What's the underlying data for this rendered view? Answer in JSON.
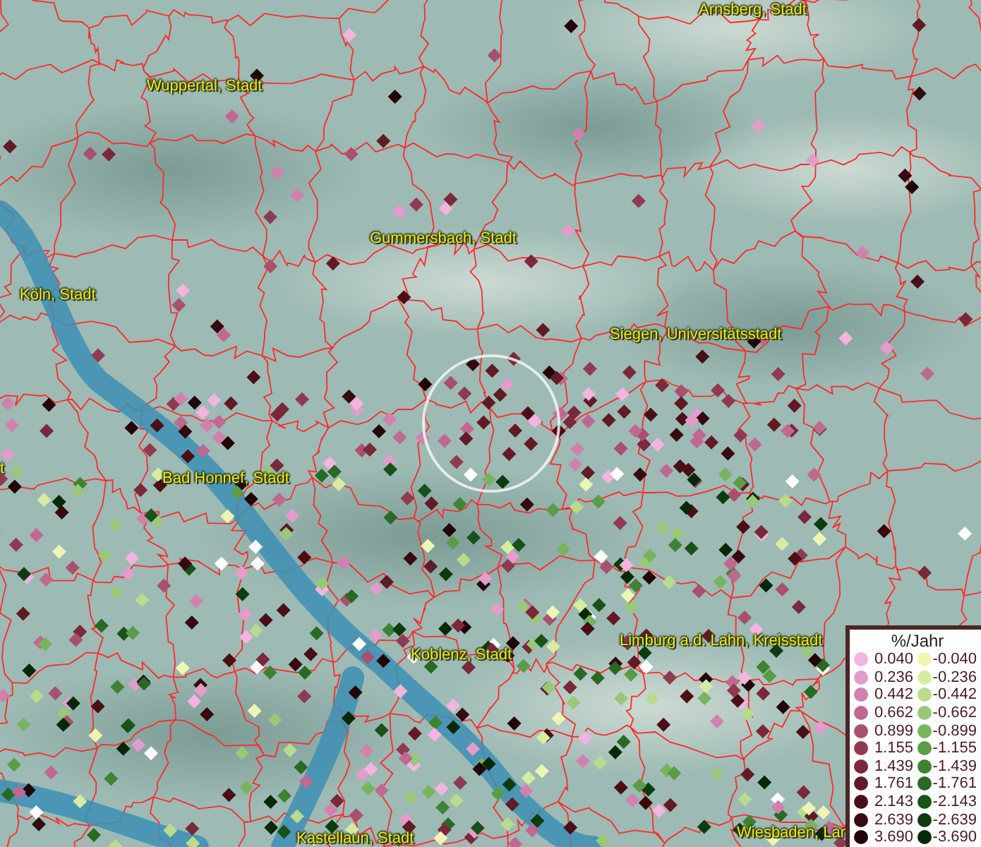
{
  "map": {
    "place_labels": [
      "Arnsberg, Stadt",
      "Wuppertal, Stadt",
      "Gummersbach, Stadt",
      "Köln, Stadt",
      "Siegen, Universitätsstadt",
      "t",
      "Bad Honnef, Stadt",
      "Limburg a.d. Lahn, Kreisstadt",
      "Koblenz, Stadt",
      "Kastellaun, Stadt",
      "Wiesbaden, Lar"
    ]
  },
  "legend": {
    "title": "%/Jahr",
    "rows": [
      {
        "positive": {
          "value": "0.040",
          "color": "#f4b4e0"
        },
        "negative": {
          "value": "-0.040",
          "color": "#eef6b4"
        }
      },
      {
        "positive": {
          "value": "0.236",
          "color": "#e49ccc"
        },
        "negative": {
          "value": "-0.236",
          "color": "#d6eca0"
        }
      },
      {
        "positive": {
          "value": "0.442",
          "color": "#d280ae"
        },
        "negative": {
          "value": "-0.442",
          "color": "#b8dc8c"
        }
      },
      {
        "positive": {
          "value": "0.662",
          "color": "#c06890"
        },
        "negative": {
          "value": "-0.662",
          "color": "#98c878"
        }
      },
      {
        "positive": {
          "value": "0.899",
          "color": "#a8506e"
        },
        "negative": {
          "value": "-0.899",
          "color": "#78b460"
        }
      },
      {
        "positive": {
          "value": "1.155",
          "color": "#903a52"
        },
        "negative": {
          "value": "-1.155",
          "color": "#5a9c48"
        }
      },
      {
        "positive": {
          "value": "1.439",
          "color": "#7a283a"
        },
        "negative": {
          "value": "-1.439",
          "color": "#3e8234"
        }
      },
      {
        "positive": {
          "value": "1.761",
          "color": "#621a24"
        },
        "negative": {
          "value": "-1.761",
          "color": "#286a24"
        }
      },
      {
        "positive": {
          "value": "2.143",
          "color": "#4a0f16"
        },
        "negative": {
          "value": "-2.143",
          "color": "#185218"
        }
      },
      {
        "positive": {
          "value": "2.639",
          "color": "#360a0e"
        },
        "negative": {
          "value": "-2.639",
          "color": "#0c3c0e"
        }
      },
      {
        "positive": {
          "value": "3.690",
          "color": "#220406"
        },
        "negative": {
          "value": "-3.690",
          "color": "#062806"
        }
      }
    ]
  }
}
